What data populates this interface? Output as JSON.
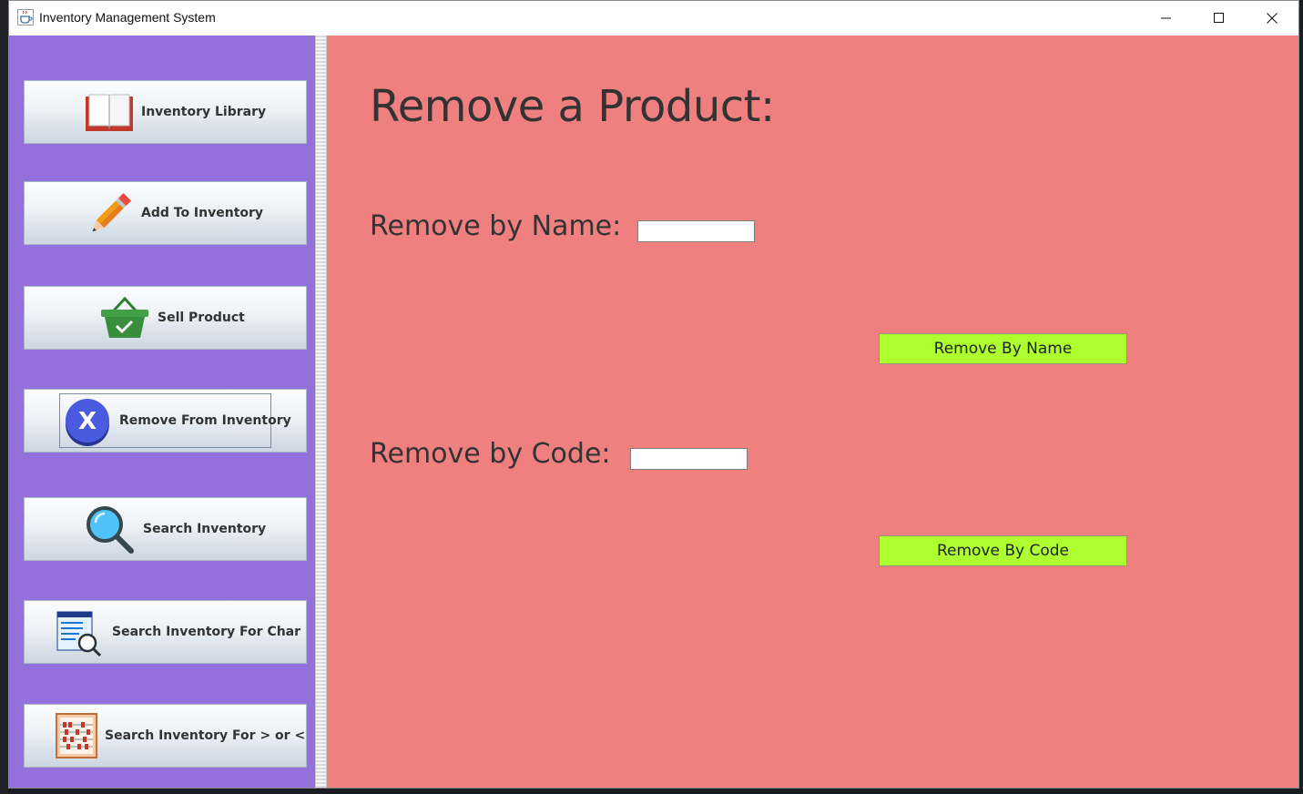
{
  "window": {
    "title": "Inventory Management System",
    "controls": [
      "minimize",
      "maximize",
      "close"
    ]
  },
  "sidebar": {
    "items": [
      {
        "label": "Inventory Library",
        "icon": "book-icon"
      },
      {
        "label": "Add To Inventory",
        "icon": "pencil-icon"
      },
      {
        "label": "Sell Product",
        "icon": "basket-icon"
      },
      {
        "label": "Remove From Inventory",
        "icon": "remove-x-icon",
        "focused": true
      },
      {
        "label": "Search Inventory",
        "icon": "magnifier-icon"
      },
      {
        "label": "Search Inventory For Char",
        "icon": "list-search-icon"
      },
      {
        "label": "Search Inventory For > or <",
        "icon": "abacus-icon"
      }
    ]
  },
  "main": {
    "title": "Remove a Product:",
    "name_label": "Remove by Name:",
    "name_value": "",
    "code_label": "Remove by Code:",
    "code_value": "",
    "remove_by_name_button": "Remove By Name",
    "remove_by_code_button": "Remove By Code"
  },
  "colors": {
    "sidebar_bg": "#9370db",
    "main_bg": "#f08080",
    "action_button_bg": "#adff2f"
  }
}
